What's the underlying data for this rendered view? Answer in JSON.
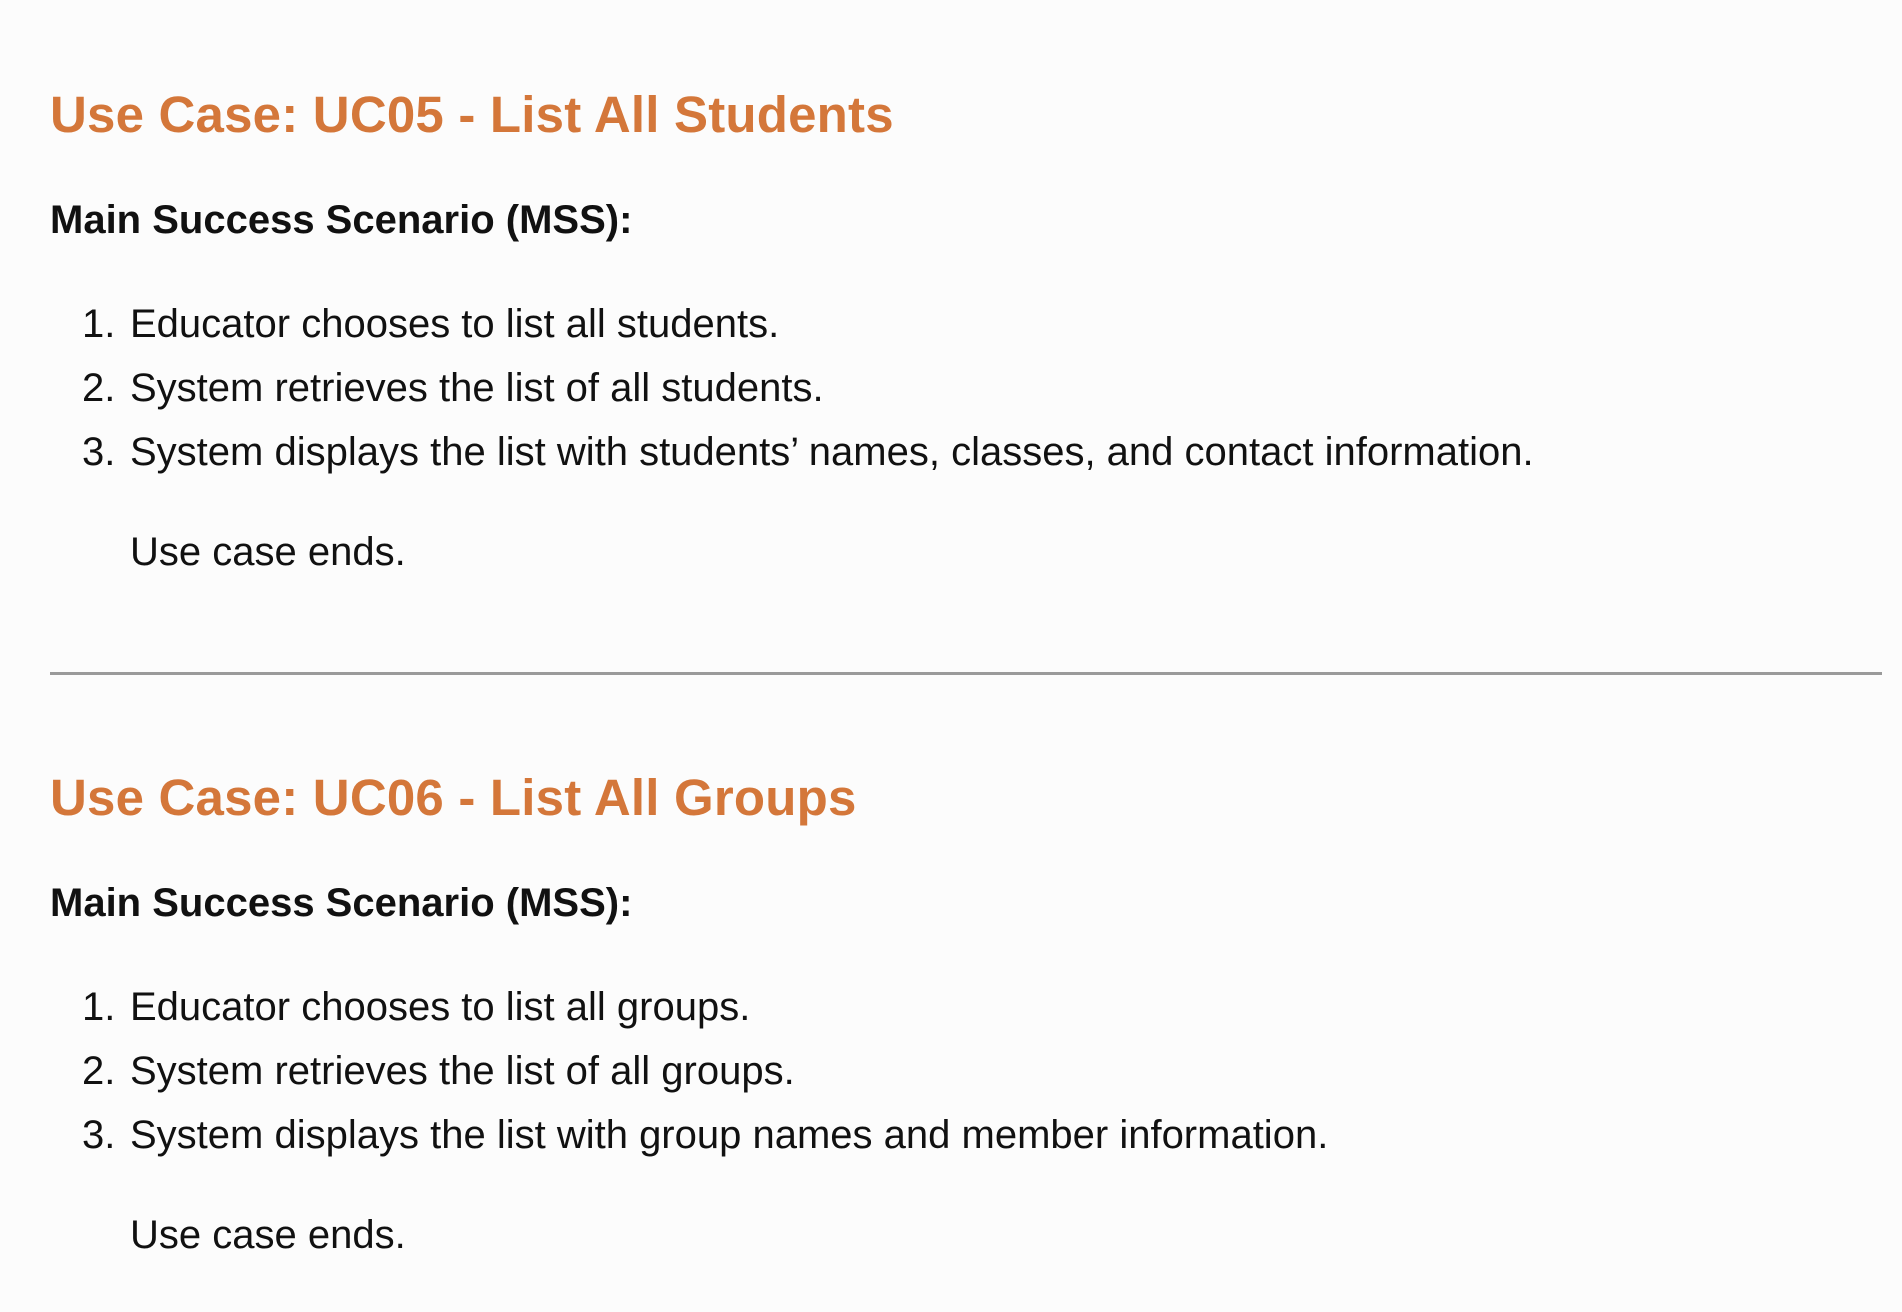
{
  "colors": {
    "accent": "#d4773a",
    "text": "#111111",
    "divider": "#9a9a9a",
    "background": "#fcfcfc"
  },
  "use_cases": [
    {
      "title": "Use Case: UC05 - List All Students",
      "mss_heading": "Main Success Scenario (MSS):",
      "steps": [
        {
          "num": "1.",
          "text": "Educator chooses to list all students."
        },
        {
          "num": "2.",
          "text": "System retrieves the list of all students."
        },
        {
          "num": "3.",
          "text": "System displays the list with students’ names, classes, and contact information."
        }
      ],
      "ending": "Use case ends."
    },
    {
      "title": "Use Case: UC06 - List All Groups",
      "mss_heading": "Main Success Scenario (MSS):",
      "steps": [
        {
          "num": "1.",
          "text": "Educator chooses to list all groups."
        },
        {
          "num": "2.",
          "text": "System retrieves the list of all groups."
        },
        {
          "num": "3.",
          "text": "System displays the list with group names and member information."
        }
      ],
      "ending": "Use case ends."
    }
  ]
}
